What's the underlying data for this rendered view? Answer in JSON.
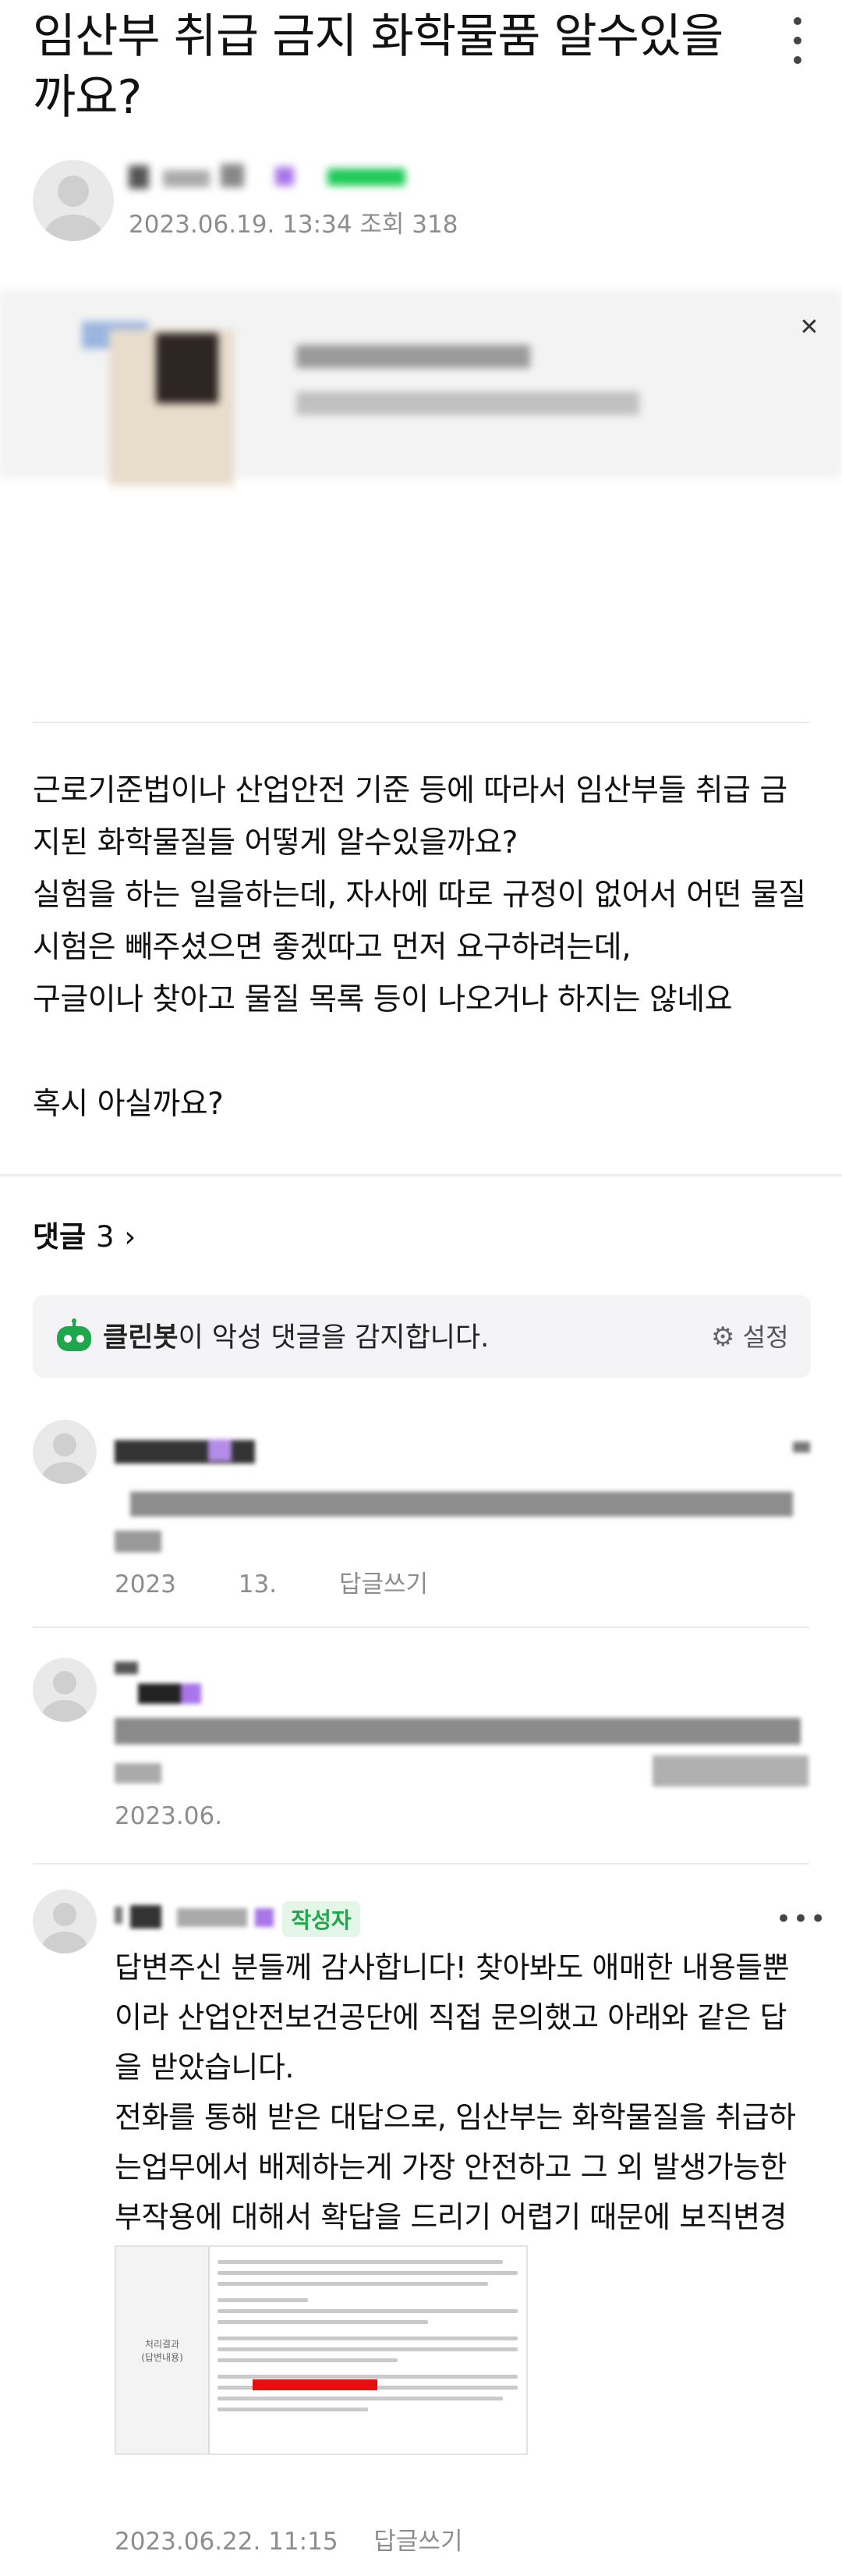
{
  "post": {
    "title": "임산부 취급 금지 화학물품 알수있을까요?",
    "meta": "2023.06.19. 13:34  조회 318",
    "body": [
      "근로기준법이나 산업안전 기준 등에 따라서 임산부들 취급 금지된 화학물질들 어떻게 알수있을까요?",
      "실험을 하는 일을하는데, 자사에 따로 규정이 없어서 어떤 물질 시험은 빼주셨으면 좋겠따고 먼저 요구하려는데,",
      "구글이나 찾아고 물질 목록 등이 나오거나 하지는 않네요",
      "",
      "혹시 아실까요?"
    ]
  },
  "comments_header": {
    "label": "댓글",
    "count": "3",
    "chevron": "chevron-right-icon"
  },
  "cleanbot": {
    "icon": "cleanbot-robot-icon",
    "name": "클린봇",
    "text": "이 악성 댓글을 감지합니다.",
    "settings_icon": "gear-icon",
    "settings_label": "설정"
  },
  "comments": [
    {
      "meta_date": "2023",
      "meta_time": "13.",
      "reply_label": "답글쓰기"
    },
    {
      "meta_date": "2023.06.",
      "meta_time": "",
      "reply_label": ""
    },
    {
      "badge": "작성자",
      "text": [
        "답변주신 분들께 감사합니다! 찾아봐도 애매한 내용들뿐이라 산업안전보건공단에 직접 문의했고 아래와 같은 답을 받았습니다.",
        "전화를 통해 받은 대답으로, 임산부는 화학물질을 취급하는업무에서 배제하는게 가장 안전하고 그 외 발생가능한 부작용에 대해서 확답을 드리기 어렵기 때문에 보직변경을 권고했습니다......................"
      ],
      "attachment_side_label": "처리결과\n(답변내용)",
      "meta": "2023.06.22. 11:15",
      "reply_label": "답글쓰기"
    }
  ],
  "colors": {
    "accent_green": "#1ea84b",
    "badge_bg": "#e3f6e7",
    "meta_gray": "#8d8d8d"
  }
}
